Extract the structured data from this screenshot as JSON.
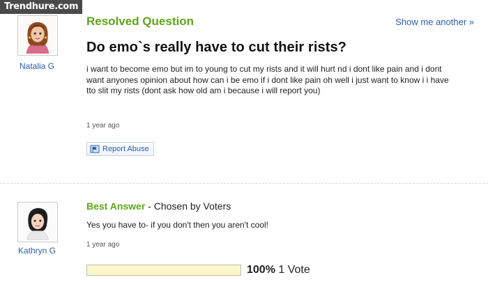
{
  "watermark": "Trendhure.com",
  "question": {
    "status": "Resolved Question",
    "show_another": "Show me another »",
    "title": "Do emo`s really have to cut their rists?",
    "body": "i want to become emo but im to young to cut my rists and it will hurt nd i dont like pain and i dont want anyones opinion about how can i be emo if i dont like pain oh well i just want to know i i have tto slit my rists (dont ask how old am i because i will report you)",
    "time": "1 year ago",
    "report_label": "Report Abuse",
    "asker": "Natalia G"
  },
  "answer": {
    "best_label": "Best Answer",
    "chosen_by": " - Chosen by Voters",
    "body": "Yes you have to- if you don't then you aren't cool!",
    "time": "1 year ago",
    "answerer": "Kathryn G",
    "vote_fraction": 1.0,
    "vote_percent": "100%",
    "vote_count": "1 Vote"
  },
  "colors": {
    "accent_green": "#5ba614",
    "link_blue": "#2a5db0",
    "vote_bar_fill": "#fbf7c8"
  },
  "icons": [
    "flag-icon",
    "avatar-natalia",
    "avatar-kathryn"
  ]
}
